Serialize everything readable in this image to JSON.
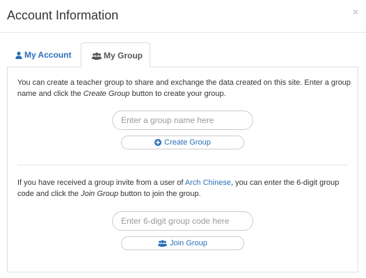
{
  "modal": {
    "title": "Account Information",
    "close_label": "×"
  },
  "tabs": [
    {
      "label": "My Account",
      "icon": "user-icon",
      "active": false
    },
    {
      "label": "My Group",
      "icon": "users-icon",
      "active": true
    }
  ],
  "create_section": {
    "text_1": "You can create a teacher group to share and exchange the data created on this site. Enter a group name and click the ",
    "text_em": "Create Group",
    "text_2": " button to create your group.",
    "input_placeholder": "Enter a group name here",
    "input_value": "",
    "button_label": "Create Group",
    "button_icon": "plus-circle-icon"
  },
  "join_section": {
    "text_1": "If you have received a group invite from a user of ",
    "link_text": "Arch Chinese",
    "text_2": ", you can enter the 6-digit group code and click the ",
    "text_em": "Join Group",
    "text_3": " button to join the group.",
    "input_placeholder": "Enter 6-digit group code here",
    "input_value": "",
    "button_label": "Join Group",
    "button_icon": "users-icon"
  },
  "colors": {
    "accent": "#2a6fb9",
    "text": "#333333",
    "border": "#dddddd"
  }
}
